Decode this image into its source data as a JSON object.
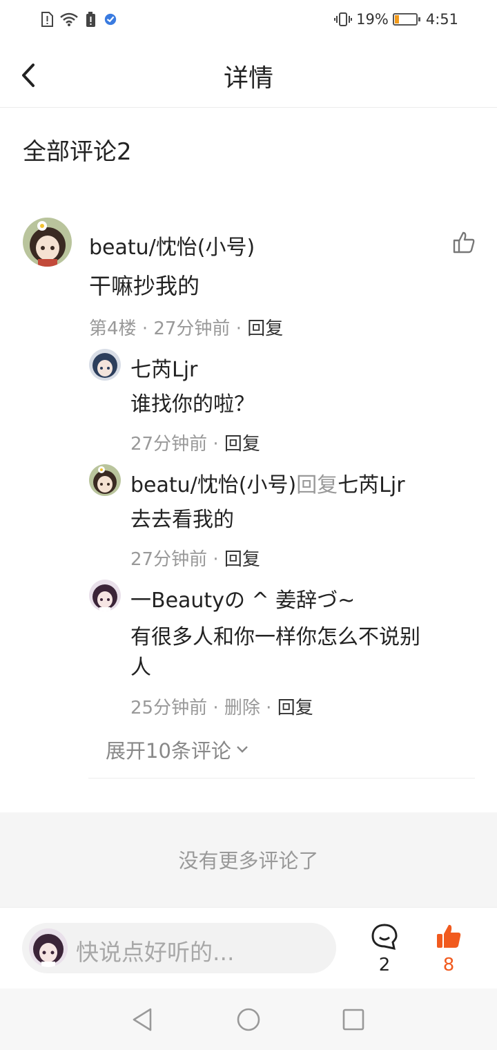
{
  "status_bar": {
    "battery": "19%",
    "time": "4:51"
  },
  "header": {
    "title": "详情"
  },
  "section": {
    "title": "全部评论2"
  },
  "comment": {
    "user": "beatu/忱怡(小号)",
    "text": "干嘛抄我的",
    "floor": "第4楼",
    "time": "27分钟前",
    "reply": "回复",
    "replies": [
      {
        "user": "七芮Ljr",
        "text": "谁找你的啦？",
        "time": "27分钟前",
        "reply": "回复"
      },
      {
        "user": "beatu/忱怡(小号)",
        "reply_word": "回复",
        "target": "七芮Ljr",
        "text": "去去看我的",
        "time": "27分钟前",
        "reply": "回复"
      },
      {
        "user": "一Beautyの ^ 姜辞づ~",
        "text_line1": "有很多人和你一样你怎么不说别",
        "text_line2": "人",
        "time": "25分钟前",
        "delete": "删除",
        "reply": "回复"
      }
    ],
    "expand": "展开10条评论"
  },
  "no_more": "没有更多评论了",
  "bottom": {
    "placeholder": "快说点好听的...",
    "comment_count": "2",
    "like_count": "8"
  },
  "colors": {
    "accent": "#f15a1e",
    "gray_text": "#999999"
  }
}
